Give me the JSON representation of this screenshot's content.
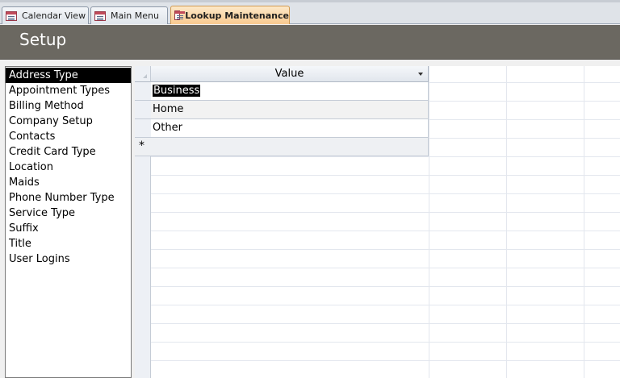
{
  "tabs": [
    {
      "label": "Calendar View",
      "active": false
    },
    {
      "label": "Main Menu",
      "active": false
    },
    {
      "label": "Lookup Maintenance",
      "active": true
    }
  ],
  "header": {
    "title": "Setup"
  },
  "lookup_list": {
    "items": [
      "Address Type",
      "Appointment Types",
      "Billing Method",
      "Company Setup",
      "Contacts",
      "Credit Card Type",
      "Location",
      "Maids",
      "Phone Number Type",
      "Service Type",
      "Suffix",
      "Title",
      "User Logins"
    ],
    "selected": "Address Type"
  },
  "datasheet": {
    "column_header": "Value",
    "rows": [
      "Business",
      "Home",
      "Other"
    ],
    "new_row_marker": "*"
  },
  "colors": {
    "header_bg": "#6b6861",
    "active_tab": "#f8c98f",
    "selection": "#000000"
  }
}
